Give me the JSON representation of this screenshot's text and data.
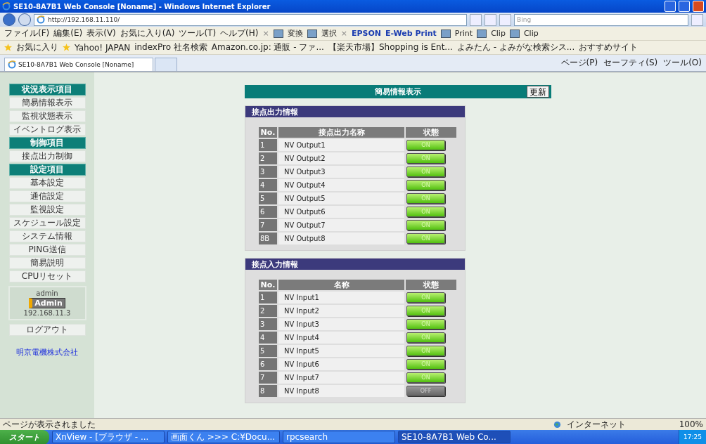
{
  "window": {
    "title": "SE10-8A7B1 Web Console [Noname] - Windows Internet Explorer"
  },
  "address_bar": {
    "value": "http://192.168.11.110/",
    "search_placeholder": "Bing"
  },
  "menu": [
    "ファイル(F)",
    "編集(E)",
    "表示(V)",
    "お気に入り(A)",
    "ツール(T)",
    "ヘルプ(H)"
  ],
  "toolbar": [
    {
      "kind": "close",
      "label": "×"
    },
    {
      "kind": "item",
      "label": "変換"
    },
    {
      "kind": "item",
      "label": "選択"
    },
    {
      "kind": "close",
      "label": "×"
    },
    {
      "kind": "brand",
      "label": "EPSON"
    },
    {
      "kind": "brand",
      "label": "E-Web Print"
    },
    {
      "kind": "item",
      "label": "Print"
    },
    {
      "kind": "item",
      "label": "Clip"
    },
    {
      "kind": "item",
      "label": "Clip"
    }
  ],
  "favorites": [
    "お気に入り",
    "Yahoo! JAPAN",
    "indexPro 社名検索",
    "Amazon.co.jp: 通販 - ファ...",
    "【楽天市場】Shopping is Ent...",
    "よみたん - よみがな検索シス...",
    "おすすめサイト"
  ],
  "tabs": [
    {
      "label": "SE10-8A7B1 Web Console [Noname]",
      "selected": true
    },
    {
      "selected": false
    }
  ],
  "command_bar": [
    "ページ(P)",
    "セーフティ(S)",
    "ツール(O)"
  ],
  "sidebar": {
    "items": [
      {
        "kind": "header",
        "label": "状況表示項目"
      },
      {
        "kind": "link",
        "label": "簡易情報表示"
      },
      {
        "kind": "link",
        "label": "監視状態表示"
      },
      {
        "kind": "link",
        "label": "イベントログ表示"
      },
      {
        "kind": "header",
        "label": "制御項目"
      },
      {
        "kind": "link",
        "label": "接点出力制御"
      },
      {
        "kind": "header",
        "label": "設定項目"
      },
      {
        "kind": "link",
        "label": "基本設定"
      },
      {
        "kind": "link",
        "label": "通信設定"
      },
      {
        "kind": "link",
        "label": "監視設定"
      },
      {
        "kind": "link",
        "label": "スケジュール設定"
      },
      {
        "kind": "link",
        "label": "システム情報"
      },
      {
        "kind": "link",
        "label": "PING送信"
      },
      {
        "kind": "link",
        "label": "簡易説明"
      },
      {
        "kind": "link",
        "label": "CPUリセット"
      }
    ],
    "user": {
      "name": "admin",
      "role": "Admin",
      "ip": "192.168.11.3"
    },
    "logout": "ログアウト",
    "company": "明京電機株式会社"
  },
  "main": {
    "title": "簡易情報表示",
    "refresh_button": "更新",
    "sections": [
      {
        "title": "接点出力情報",
        "columns": [
          "No.",
          "接点出力名称",
          "状態"
        ],
        "rows": [
          {
            "no": "1",
            "name": "NV Output1",
            "status": "ON",
            "on": true
          },
          {
            "no": "2",
            "name": "NV Output2",
            "status": "ON",
            "on": true
          },
          {
            "no": "3",
            "name": "NV Output3",
            "status": "ON",
            "on": true
          },
          {
            "no": "4",
            "name": "NV Output4",
            "status": "ON",
            "on": true
          },
          {
            "no": "5",
            "name": "NV Output5",
            "status": "ON",
            "on": true
          },
          {
            "no": "6",
            "name": "NV Output6",
            "status": "ON",
            "on": true
          },
          {
            "no": "7",
            "name": "NV Output7",
            "status": "ON",
            "on": true
          },
          {
            "no": "8B",
            "name": "NV Output8",
            "status": "ON",
            "on": true
          }
        ]
      },
      {
        "title": "接点入力情報",
        "columns": [
          "No.",
          "名称",
          "状態"
        ],
        "rows": [
          {
            "no": "1",
            "name": "NV Input1",
            "status": "ON",
            "on": true
          },
          {
            "no": "2",
            "name": "NV Input2",
            "status": "ON",
            "on": true
          },
          {
            "no": "3",
            "name": "NV Input3",
            "status": "ON",
            "on": true
          },
          {
            "no": "4",
            "name": "NV Input4",
            "status": "ON",
            "on": true
          },
          {
            "no": "5",
            "name": "NV Input5",
            "status": "ON",
            "on": true
          },
          {
            "no": "6",
            "name": "NV Input6",
            "status": "ON",
            "on": true
          },
          {
            "no": "7",
            "name": "NV Input7",
            "status": "ON",
            "on": true
          },
          {
            "no": "8",
            "name": "NV Input8",
            "status": "OFF",
            "on": false
          }
        ]
      }
    ]
  },
  "status_bar": {
    "message": "ページが表示されました",
    "zone": "インターネット",
    "zoom": "100%"
  },
  "taskbar": {
    "start": "スタート",
    "windows": [
      {
        "label": "XnView - [ブラウザ - ...",
        "selected": false
      },
      {
        "label": "画面くん >>> C:¥Docu...",
        "selected": false
      },
      {
        "label": "rpcsearch",
        "selected": false
      },
      {
        "label": "SE10-8A7B1 Web Co...",
        "selected": true
      }
    ],
    "clock": "17:25"
  }
}
